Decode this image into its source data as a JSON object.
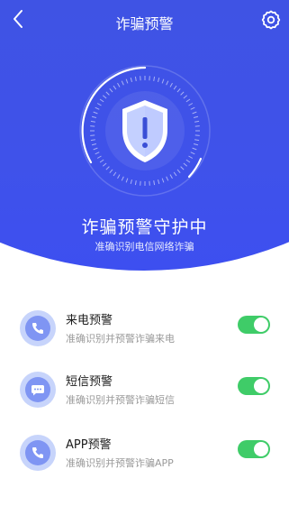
{
  "header": {
    "title": "诈骗预警"
  },
  "hero": {
    "title": "诈骗预警守护中",
    "subtitle": "准确识别电信网络诈骗"
  },
  "items": [
    {
      "label": "来电预警",
      "desc": "准确识别并预警诈骗来电",
      "icon": "phone-icon",
      "enabled": true
    },
    {
      "label": "短信预警",
      "desc": "准确识别并预警诈骗短信",
      "icon": "message-icon",
      "enabled": true
    },
    {
      "label": "APP预警",
      "desc": "准确识别并预警诈骗APP",
      "icon": "phone-icon",
      "enabled": true
    }
  ],
  "colors": {
    "primary": "#3f52ea",
    "toggle_on": "#3fcc68",
    "icon_bg": "#c7d4fb",
    "icon_fg": "#7f95f3"
  }
}
